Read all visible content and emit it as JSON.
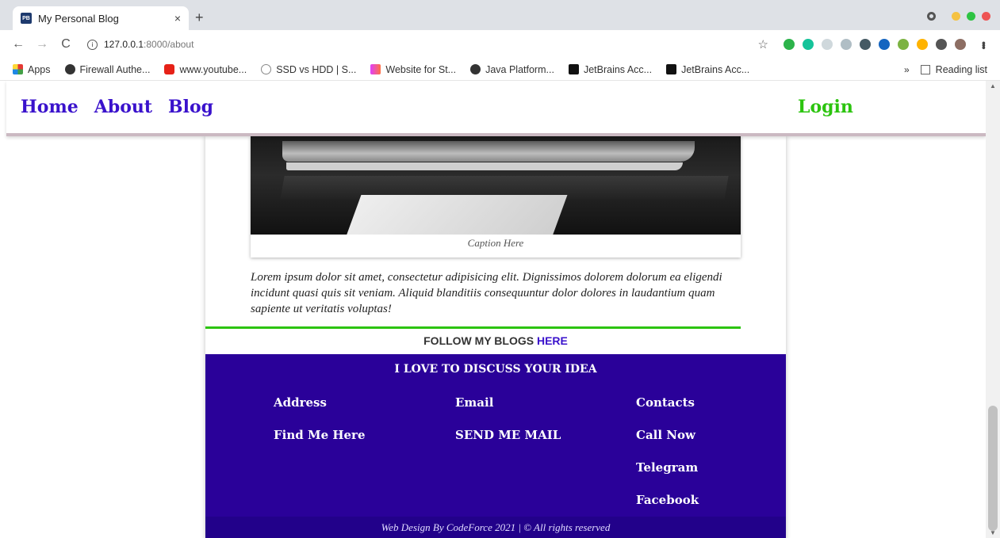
{
  "browser": {
    "tab_title": "My Personal Blog",
    "tab_favicon_text": "PB",
    "tab_close": "×",
    "new_tab": "+",
    "url_host": "127.0.0.1",
    "url_path": ":8000/about",
    "back": "←",
    "forward": "→",
    "reload": "C",
    "star": "☆",
    "bookmarks": [
      {
        "label": "Apps",
        "icon": "apps-grid-icon",
        "color": "#e53935"
      },
      {
        "label": "Firewall Authe...",
        "icon": "globe-icon",
        "color": "#333333"
      },
      {
        "label": "www.youtube...",
        "icon": "youtube-icon",
        "color": "#e62117"
      },
      {
        "label": "SSD vs HDD | S...",
        "icon": "site-icon",
        "color": "#888888"
      },
      {
        "label": "Website for St...",
        "icon": "w-logo-icon",
        "color": "#e040fb"
      },
      {
        "label": "Java Platform...",
        "icon": "globe-icon",
        "color": "#333333"
      },
      {
        "label": "JetBrains Acc...",
        "icon": "jetbrains-icon",
        "color": "#111111"
      },
      {
        "label": "JetBrains Acc...",
        "icon": "jetbrains-icon",
        "color": "#111111"
      }
    ],
    "bookmarks_more": "»",
    "reading_list": "Reading list"
  },
  "nav": {
    "home": "Home",
    "about": "About",
    "blog": "Blog",
    "login": "Login"
  },
  "article": {
    "caption": "Caption Here",
    "body": "Lorem ipsum dolor sit amet, consectetur adipisicing elit. Dignissimos dolorem dolorum ea eligendi incidunt quasi quis sit veniam. Aliquid blanditiis consequuntur dolor dolores in laudantium quam sapiente ut veritatis voluptas!",
    "follow_text": "FOLLOW MY BLOGS ",
    "follow_link": "HERE"
  },
  "footer": {
    "title": "I LOVE TO DISCUSS YOUR IDEA",
    "address_head": "Address",
    "address_item": "Find Me Here",
    "email_head": "Email",
    "email_item": "SEND ME MAIL",
    "contacts_head": "Contacts",
    "contacts_items": [
      "Call Now",
      "Telegram",
      "Facebook"
    ],
    "copyright": "Web Design By CodeForce 2021 | © All rights reserved"
  },
  "colors": {
    "nav_link": "#3a12cc",
    "login": "#2cc40f",
    "footer_bg": "#2a0199",
    "accent_line": "#2cc40f"
  }
}
